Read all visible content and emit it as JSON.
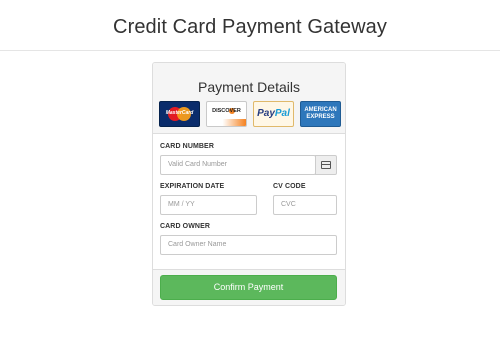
{
  "header": {
    "title": "Credit Card Payment Gateway"
  },
  "panel": {
    "title": "Payment Details",
    "card_logos": {
      "mastercard": "MasterCard",
      "discover": "DISCOVER",
      "paypal_a": "Pay",
      "paypal_b": "Pal",
      "amex_1": "AMERICAN",
      "amex_2": "EXPRESS"
    }
  },
  "form": {
    "card_number": {
      "label": "CARD NUMBER",
      "placeholder": "Valid Card Number"
    },
    "expiration": {
      "label": "EXPIRATION DATE",
      "placeholder": "MM / YY"
    },
    "cvc": {
      "label": "CV CODE",
      "placeholder": "CVC"
    },
    "owner": {
      "label": "CARD OWNER",
      "placeholder": "Card Owner Name"
    }
  },
  "footer": {
    "confirm_label": "Confirm Payment"
  },
  "colors": {
    "confirm_button": "#5cb85c",
    "panel_bg": "#f5f5f5"
  },
  "icons": {
    "card_addon": "credit-card-icon"
  }
}
